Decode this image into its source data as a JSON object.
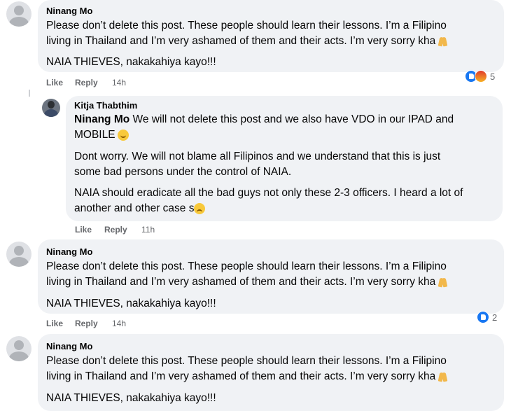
{
  "comments": [
    {
      "author": "Ninang Mo",
      "lines": [
        "Please don’t delete this post. These people should learn their lessons. I’m a Filipino",
        "living in Thailand and I’m very ashamed of them and their acts. I’m very sorry kha"
      ],
      "emoji": "folded-hands",
      "second_para": "NAIA THIEVES, nakakahiya kayo!!!",
      "like_label": "Like",
      "reply_label": "Reply",
      "time": "14h",
      "reaction_count": "5"
    },
    {
      "author": "Ninang Mo",
      "lines": [
        "Please don’t delete this post. These people should learn their lessons. I’m a Filipino",
        "living in Thailand and I’m very ashamed of them and their acts. I’m very sorry kha"
      ],
      "emoji": "folded-hands",
      "second_para": "NAIA THIEVES, nakakahiya kayo!!!",
      "like_label": "Like",
      "reply_label": "Reply",
      "time": "14h",
      "reaction_count": "2"
    },
    {
      "author": "Ninang Mo",
      "lines": [
        "Please don’t delete this post. These people should learn their lessons. I’m a Filipino",
        "living in Thailand and I’m very ashamed of them and their acts. I’m very sorry kha"
      ],
      "emoji": "folded-hands",
      "second_para": "NAIA THIEVES, nakakahiya kayo!!!"
    }
  ],
  "reply": {
    "author": "Kitja Thabthim",
    "mention": "Ninang Mo",
    "line1_rest": " We will not delete this post and we also have VDO in our IPAD and",
    "line2": "MOBILE",
    "para2_line1": "Dont worry. We will not blame all Filipinos and we understand that this is just",
    "para2_line2": "some bad persons under the control of NAIA.",
    "para3_line1": "NAIA should eradicate all the bad guys not only these 2-3 officers. I heard a lot of",
    "para3_line2": "another and other case s",
    "like_label": "Like",
    "reply_label": "Reply",
    "time": "11h"
  }
}
